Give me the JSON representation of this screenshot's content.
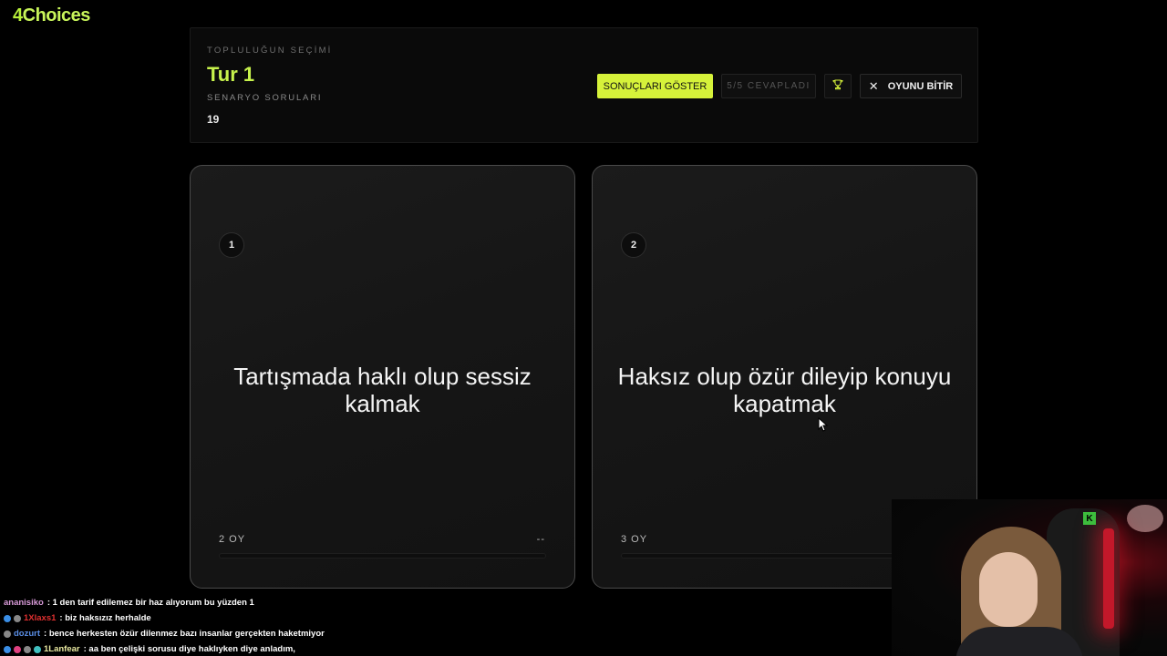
{
  "logo": {
    "four": "4",
    "rest": "Choices"
  },
  "header": {
    "eyebrow": "TOPLULUĞUN SEÇİMİ",
    "title": "Tur 1",
    "subtitle": "SENARYO SORULARI",
    "number": "19",
    "buttons": {
      "show_results": "SONUÇLARI GÖSTER",
      "answered": "5/5 CEVAPLADI",
      "end_game": "OYUNU BİTİR"
    }
  },
  "cards": [
    {
      "number": "1",
      "text": "Tartışmada haklı olup sessiz kalmak",
      "votes": "2 OY",
      "percent": "--"
    },
    {
      "number": "2",
      "text": "Haksız olup özür dileyip konuyu kapatmak",
      "votes": "3 OY",
      "percent": ""
    }
  ],
  "chat": [
    {
      "user": "ananisiko",
      "user_color": "#d89ad8",
      "message": ": 1 den tarif edilemez bir haz alıyorum bu yüzden 1",
      "icons": []
    },
    {
      "user": "1Xlaxs1",
      "user_color": "#e03030",
      "message": ": biz haksızız herhalde",
      "icons": [
        "#3a8ee6",
        "#888888"
      ]
    },
    {
      "user": "dozurt",
      "user_color": "#5a8ee6",
      "message": ": bence herkesten özür dilenmez bazı insanlar gerçekten haketmiyor",
      "icons": [
        "#888888"
      ]
    },
    {
      "user": "1Lanfear",
      "user_color": "#e8e8a0",
      "message": ": aa ben çelişki sorusu diye haklıyken diye anladım,",
      "icons": [
        "#3a8ee6",
        "#e04080",
        "#888888",
        "#40c0c0"
      ]
    }
  ],
  "colors": {
    "accent": "#d6f23a",
    "title": "#c7f24c"
  },
  "icons": {
    "trophy": "trophy-icon",
    "close": "close-icon",
    "cursor": "mouse-cursor-icon"
  }
}
